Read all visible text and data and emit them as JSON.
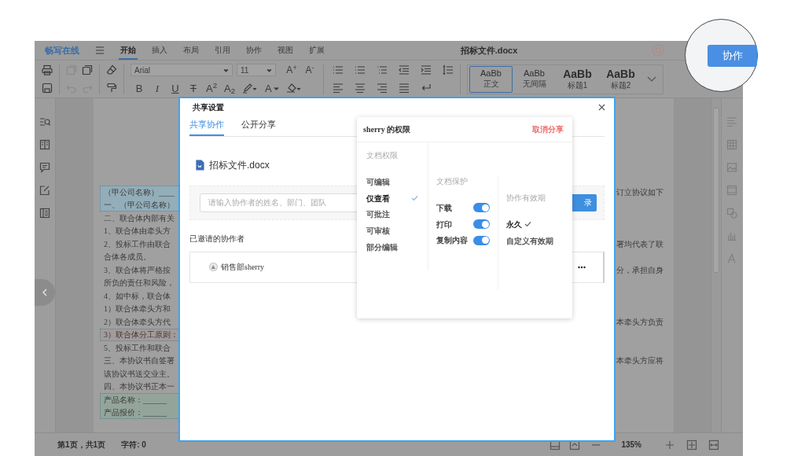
{
  "app": {
    "logo": "畅写在线",
    "menu_tabs": [
      {
        "label": "开始",
        "selected": true
      },
      {
        "label": "插入",
        "selected": false
      },
      {
        "label": "布局",
        "selected": false
      },
      {
        "label": "引用",
        "selected": false
      },
      {
        "label": "协作",
        "selected": false
      },
      {
        "label": "视图",
        "selected": false
      },
      {
        "label": "扩展",
        "selected": false
      }
    ],
    "document_title": "招标文件.docx"
  },
  "toolbar": {
    "font": "Arial",
    "font_size": "11",
    "size_buttons": [
      "A$^{+}$",
      "A$^{-}$"
    ],
    "format_buttons": [
      {
        "glyph": "B",
        "kind": "bold"
      },
      {
        "glyph": "I",
        "kind": "italic"
      },
      {
        "glyph": "U",
        "kind": "underline"
      },
      {
        "glyph": "T",
        "kind": "strike"
      },
      {
        "glyph": "A$^{2}$",
        "kind": "plain"
      },
      {
        "glyph": "A$_{2}$",
        "kind": "plain"
      }
    ],
    "font_color_glyph": "A",
    "styles": [
      {
        "preview": "AaBb",
        "label": "正文",
        "kind": "body",
        "selected": true
      },
      {
        "preview": "AaBb",
        "label": "无间隔",
        "kind": "body",
        "selected": false
      },
      {
        "preview": "AaBb",
        "label": "标题1",
        "kind": "heading",
        "selected": false
      },
      {
        "preview": "AaBb",
        "label": "标题2",
        "kind": "heading",
        "selected": false
      }
    ]
  },
  "document": {
    "blocks": [
      {
        "kind": "content-control",
        "color": "#93adb9",
        "lines": [
          {
            "left": "（甲公司名称）____",
            "right": "订立协议如下"
          },
          {
            "left": "一、（甲公司名称）"
          }
        ]
      },
      {
        "kind": "plain",
        "lines": [
          {
            "left": "二、联合体内部有关"
          },
          {
            "left": "1、联合体由牵头方"
          },
          {
            "left": "2、投标工作由联合",
            "right": "署均代表了联"
          },
          {
            "left": "合体各成员。"
          },
          {
            "left": "3、联合体将严格按",
            "right": "分，承担自身"
          },
          {
            "left": "所负的责任和风险，"
          },
          {
            "left": "4、如中标，联合体"
          },
          {
            "left": "1）联合体牵头方和"
          },
          {
            "left": "2）联合体牵头方代",
            "right": "本牵头方负责"
          }
        ]
      },
      {
        "kind": "content-control",
        "color": "#a39b99",
        "lines": [
          {
            "left": "3）联合体分工原则："
          }
        ]
      },
      {
        "kind": "plain",
        "lines": [
          {
            "left": "5、投标工作和联合"
          },
          {
            "left": "三、本协议书自签署",
            "right": "本牵头方应将"
          },
          {
            "left": "该协议书送交业主。"
          },
          {
            "left": "四、本协议书正本一"
          }
        ]
      },
      {
        "kind": "content-control",
        "color": "#93a59b",
        "lines": [
          {
            "left": "产品名称：______"
          },
          {
            "left": "产品报价：______"
          }
        ]
      }
    ]
  },
  "status_bar": {
    "page": "第1页，共1页",
    "characters": "字符: 0",
    "zoom": "135%"
  },
  "share_dialog": {
    "title": "共享设置",
    "tabs": [
      {
        "label": "共享协作",
        "selected": true
      },
      {
        "label": "公开分享",
        "selected": false
      }
    ],
    "file_name": "招标文件.docx",
    "search_placeholder": "请输入协作者的姓名、部门、团队",
    "contacts_button": "录",
    "invited_heading": "已邀请的协作者",
    "collaborators": [
      {
        "name": "销售部sherry"
      }
    ]
  },
  "permissions_popover": {
    "title": "sherry 的权限",
    "cancel": "取消分享",
    "permissions": {
      "heading": "文档权限",
      "options": [
        {
          "label": "可编辑",
          "selected": false
        },
        {
          "label": "仅查看",
          "selected": true
        },
        {
          "label": "可批注",
          "selected": false
        },
        {
          "label": "可审核",
          "selected": false
        },
        {
          "label": "部分编辑",
          "selected": false
        }
      ]
    },
    "protection": {
      "heading": "文档保护",
      "items": [
        {
          "label": "下载",
          "on": true
        },
        {
          "label": "打印",
          "on": true
        },
        {
          "label": "复制内容",
          "on": true
        }
      ]
    },
    "validity": {
      "heading": "协作有效期",
      "options": [
        {
          "label": "永久",
          "selected": true
        },
        {
          "label": "自定义有效期",
          "selected": false
        }
      ]
    }
  },
  "magnifier": {
    "button": "协作"
  }
}
